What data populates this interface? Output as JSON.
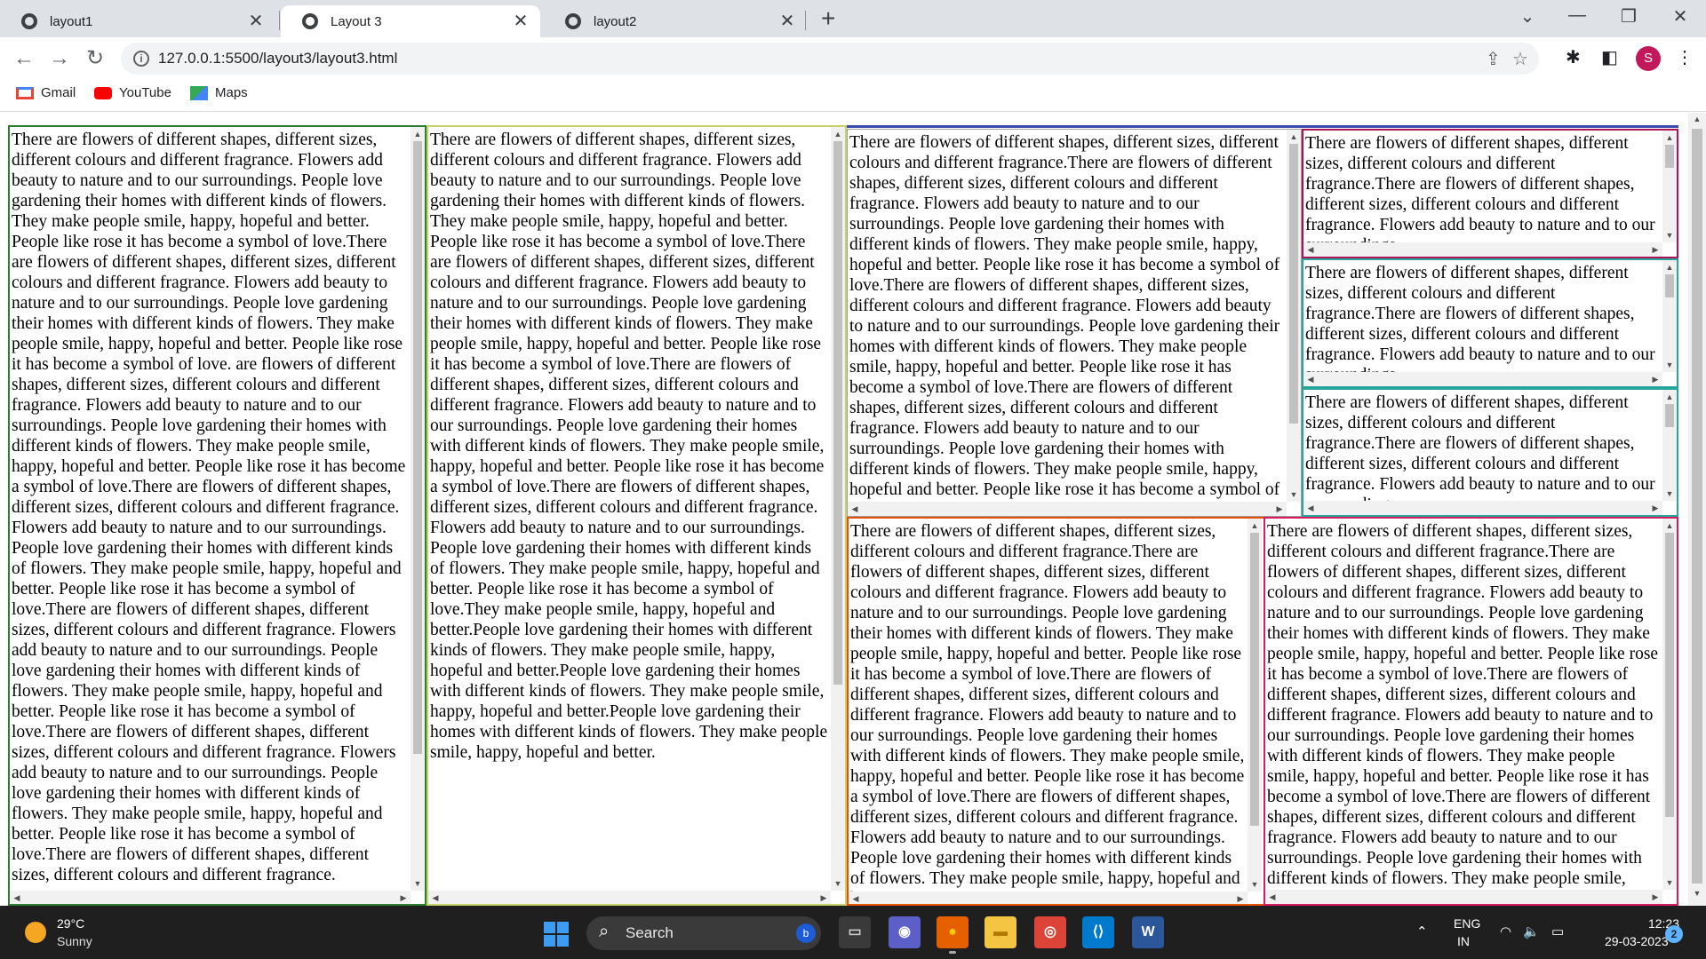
{
  "tabs": [
    {
      "title": "layout1",
      "close": "✕"
    },
    {
      "title": "Layout 3",
      "close": "✕"
    },
    {
      "title": "layout2",
      "close": "✕"
    }
  ],
  "new_tab": "+",
  "window_controls": {
    "search_tabs": "⌄",
    "minimize": "—",
    "maximize": "❐",
    "close": "✕"
  },
  "nav": {
    "back": "←",
    "forward": "→",
    "reload": "↻"
  },
  "address": {
    "url": "127.0.0.1:5500/layout3/layout3.html",
    "info": "i"
  },
  "toolbar": {
    "share": "⇪",
    "star": "☆",
    "extensions": "✱",
    "sidepanel": "◧",
    "profile_initial": "S",
    "menu": "⋮"
  },
  "bookmarks": [
    {
      "label": "Gmail",
      "icon": "gmail-icon",
      "color": "#ea4335"
    },
    {
      "label": "YouTube",
      "icon": "youtube-icon",
      "color": "#ff0000"
    },
    {
      "label": "Maps",
      "icon": "maps-icon",
      "color": "#34a853"
    }
  ],
  "content": {
    "box1": "There are flowers of different shapes, different sizes, different colours and different fragrance. Flowers add beauty to nature and to our surroundings. People love gardening their homes with different kinds of flowers. They make people smile, happy, hopeful and better. People like rose it has become a symbol of love.There are flowers of different shapes, different sizes, different colours and different fragrance. Flowers add beauty to nature and to our surroundings. People love gardening their homes with different kinds of flowers. They make people smile, happy, hopeful and better. People like rose it has become a symbol of love. are flowers of different shapes, different sizes, different colours and different fragrance. Flowers add beauty to nature and to our surroundings. People love gardening their homes with different kinds of flowers. They make people smile, happy, hopeful and better. People like rose it has become a symbol of love.There are flowers of different shapes, different sizes, different colours and different fragrance. Flowers add beauty to nature and to our surroundings. People love gardening their homes with different kinds of flowers. They make people smile, happy, hopeful and better. People like rose it has become a symbol of love.There are flowers of different shapes, different sizes, different colours and different fragrance. Flowers add beauty to nature and to our surroundings. People love gardening their homes with different kinds of flowers. They make people smile, happy, hopeful and better. People like rose it has become a symbol of love.There are flowers of different shapes, different sizes, different colours and different fragrance. Flowers add beauty to nature and to our surroundings. People love gardening their homes with different kinds of flowers. They make people smile, happy, hopeful and better. People like rose it has become a symbol of love.There are flowers of different shapes, different sizes, different colours and different fragrance.",
    "box2": "There are flowers of different shapes, different sizes, different colours and different fragrance. Flowers add beauty to nature and to our surroundings. People love gardening their homes with different kinds of flowers. They make people smile, happy, hopeful and better. People like rose it has become a symbol of love.There are flowers of different shapes, different sizes, different colours and different fragrance. Flowers add beauty to nature and to our surroundings. People love gardening their homes with different kinds of flowers. They make people smile, happy, hopeful and better. People like rose it has become a symbol of love.There are flowers of different shapes, different sizes, different colours and different fragrance. Flowers add beauty to nature and to our surroundings. People love gardening their homes with different kinds of flowers. They make people smile, happy, hopeful and better. People like rose it has become a symbol of love.There are flowers of different shapes, different sizes, different colours and different fragrance. Flowers add beauty to nature and to our surroundings. People love gardening their homes with different kinds of flowers. They make people smile, happy, hopeful and better. People like rose it has become a symbol of love.They make people smile, happy, hopeful and better.People love gardening their homes with different kinds of flowers. They make people smile, happy, hopeful and better.People love gardening their homes with different kinds of flowers. They make people smile, happy, hopeful and better.People love gardening their homes with different kinds of flowers. They make people smile, happy, hopeful and better.",
    "box3": "There are flowers of different shapes, different sizes, different colours and different fragrance.There are flowers of different shapes, different sizes, different colours and different fragrance. Flowers add beauty to nature and to our surroundings. People love gardening their homes with different kinds of flowers. They make people smile, happy, hopeful and better. People like rose it has become a symbol of love.There are flowers of different shapes, different sizes, different colours and different fragrance. Flowers add beauty to nature and to our surroundings. People love gardening their homes with different kinds of flowers. They make people smile, happy, hopeful and better. People like rose it has become a symbol of love.There are flowers of different shapes, different sizes, different colours and different fragrance. Flowers add beauty to nature and to our surroundings. People love gardening their homes with different kinds of flowers. They make people smile, happy, hopeful and better. People like rose it has become a symbol of love.",
    "small": "There are flowers of different shapes, different sizes, different colours and different fragrance.There are flowers of different shapes, different sizes, different colours and different fragrance. Flowers add beauty to nature and to our surroundings.",
    "box7": "There are flowers of different shapes, different sizes, different colours and different fragrance.There are flowers of different shapes, different sizes, different colours and different fragrance. Flowers add beauty to nature and to our surroundings. People love gardening their homes with different kinds of flowers. They make people smile, happy, hopeful and better. People like rose it has become a symbol of love.There are flowers of different shapes, different sizes, different colours and different fragrance. Flowers add beauty to nature and to our surroundings. People love gardening their homes with different kinds of flowers. They make people smile, happy, hopeful and better. People like rose it has become a symbol of love.There are flowers of different shapes, different sizes, different colours and different fragrance. Flowers add beauty to nature and to our surroundings. People love gardening their homes with different kinds of flowers. They make people smile, happy, hopeful and better.",
    "box8": "There are flowers of different shapes, different sizes, different colours and different fragrance.There are flowers of different shapes, different sizes, different colours and different fragrance. Flowers add beauty to nature and to our surroundings. People love gardening their homes with different kinds of flowers. They make people smile, happy, hopeful and better. People like rose it has become a symbol of love.There are flowers of different shapes, different sizes, different colours and different fragrance. Flowers add beauty to nature and to our surroundings. People love gardening their homes with different kinds of flowers. They make people smile, happy, hopeful and better. People like rose it has become a symbol of love.There are flowers of different shapes, different sizes, different colours and different fragrance. Flowers add beauty to nature and to our surroundings. People love gardening their homes with different kinds of flowers. They make people smile, happy, hopeful and better."
  },
  "border_colors": {
    "box1": "#2e7d32",
    "box2": "#c6d36b",
    "box3_top": "#3949ab",
    "box3": "#9e9e9e",
    "small1": "#ad1457",
    "small2": "#26a69a",
    "small3": "#26a69a",
    "box7": "#e65100",
    "box8": "#d81b60"
  },
  "taskbar": {
    "weather": {
      "temp": "29°C",
      "desc": "Sunny"
    },
    "search_label": "Search",
    "search_icon": "⌕",
    "bing_icon": "b",
    "apps": [
      {
        "name": "task-view",
        "glyph": "▭",
        "bg": "#3a3a3a",
        "fg": "#cfcfcf"
      },
      {
        "name": "teams-chat",
        "glyph": "◉",
        "bg": "#5b5fc7",
        "fg": "#ffffff"
      },
      {
        "name": "firefox",
        "glyph": "●",
        "bg": "#e66000",
        "fg": "#ffcc00"
      },
      {
        "name": "file-explorer",
        "glyph": "▬",
        "bg": "#f4c542",
        "fg": "#b37a00"
      },
      {
        "name": "chrome",
        "glyph": "◎",
        "bg": "#db4437",
        "fg": "#ffffff"
      },
      {
        "name": "vscode",
        "glyph": "⟨⟩",
        "bg": "#007acc",
        "fg": "#ffffff"
      },
      {
        "name": "word",
        "glyph": "W",
        "bg": "#2b579a",
        "fg": "#ffffff"
      }
    ],
    "tray": {
      "chevron": "⌃",
      "lang_top": "ENG",
      "lang_bottom": "IN",
      "wifi": "◠",
      "volume": "🔈",
      "battery": "▭"
    },
    "time": "12:23",
    "date": "29-03-2023",
    "notifications": "2"
  }
}
